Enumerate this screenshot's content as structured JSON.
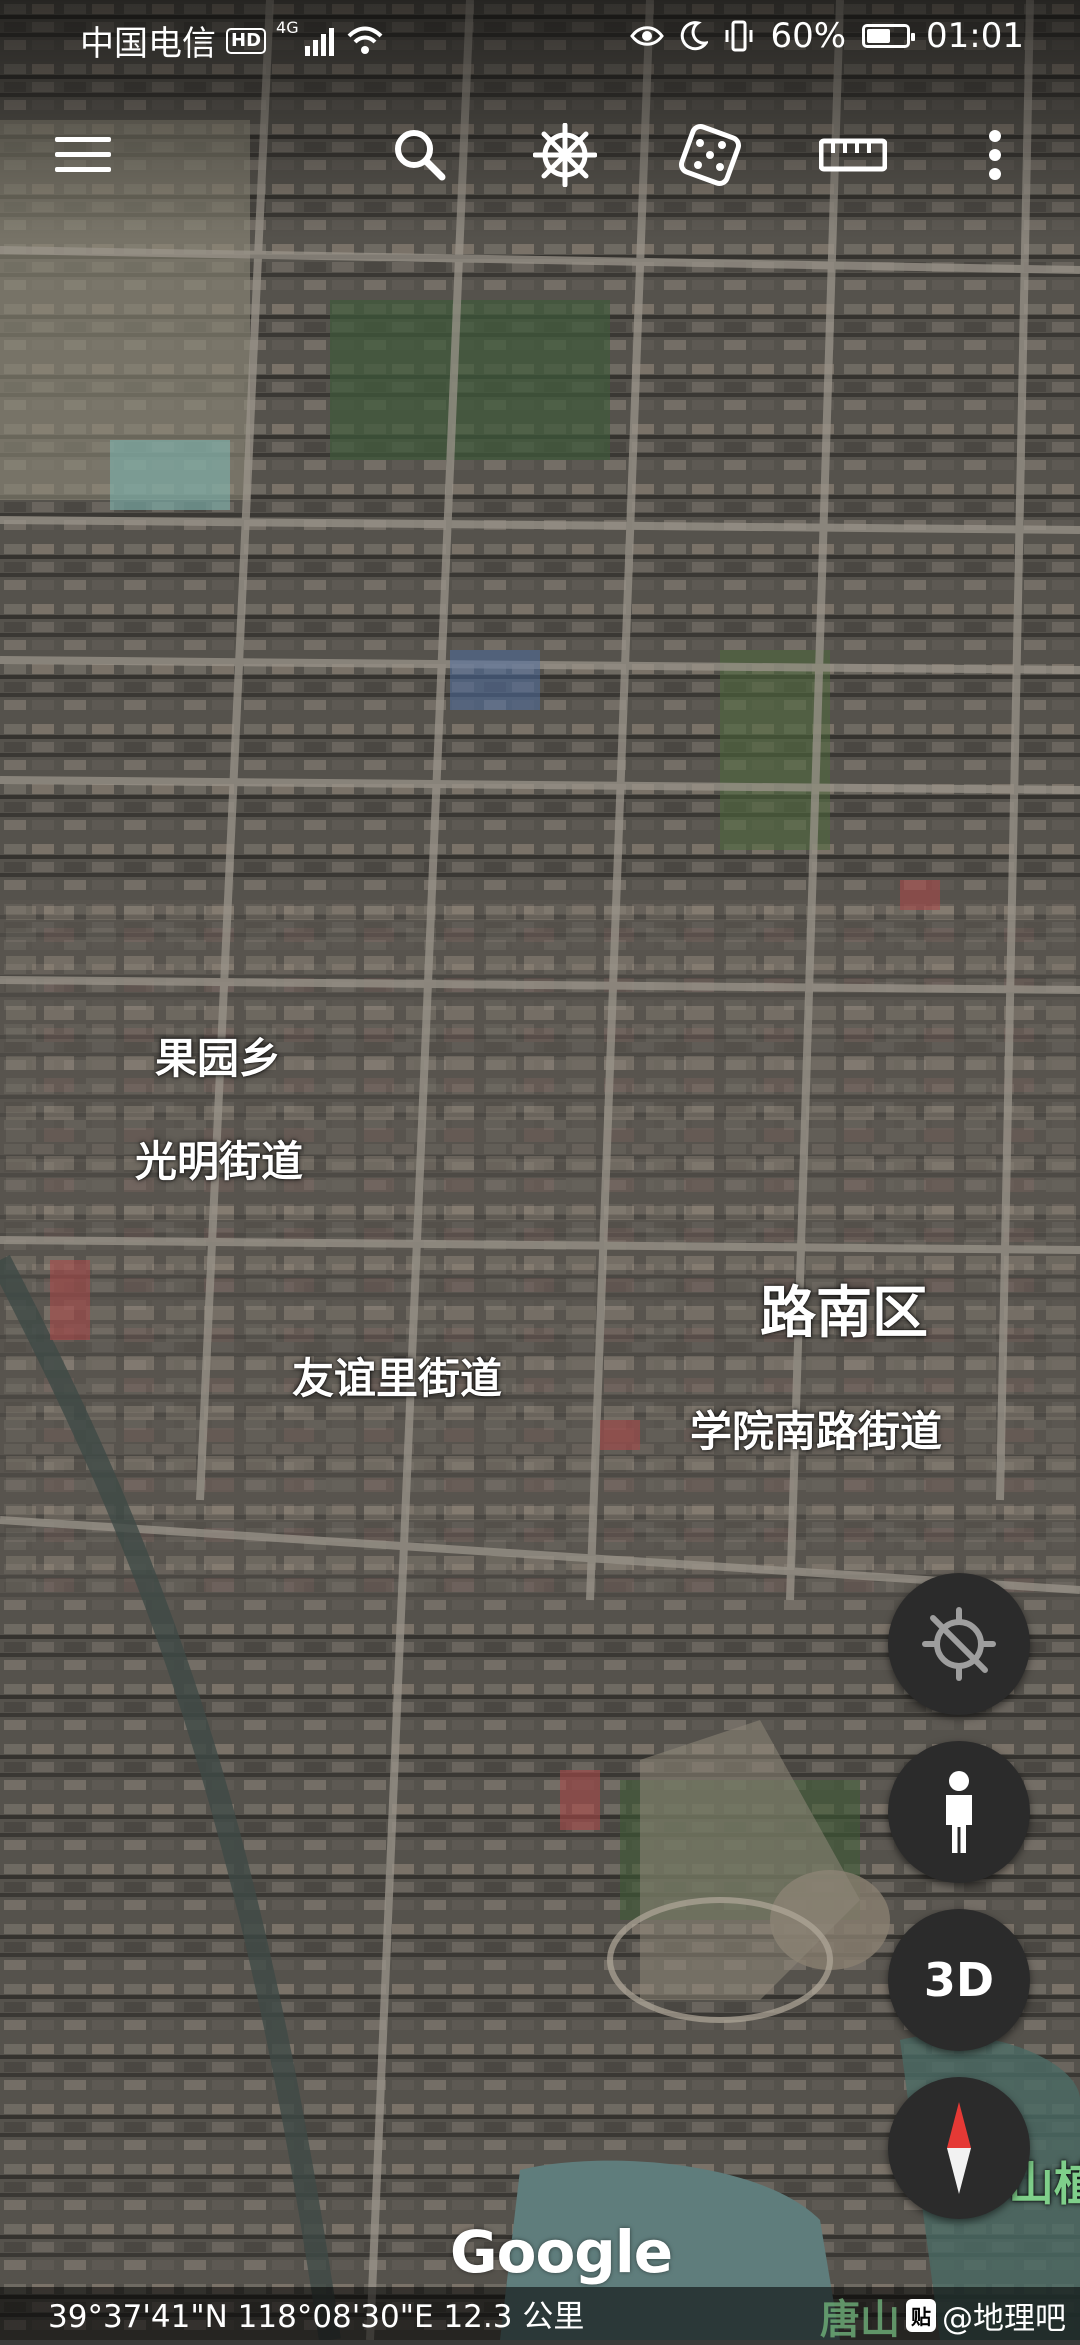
{
  "status_bar": {
    "carrier": "中国电信",
    "hd": "HD",
    "network": "4G",
    "battery": "60%",
    "battery_level": 0.6,
    "time": "01:01"
  },
  "toolbar": {
    "icons": [
      "menu-icon",
      "search-icon",
      "voyager-wheel-icon",
      "dice-icon",
      "ruler-icon",
      "more-icon"
    ]
  },
  "map_labels": {
    "guoyuan": "果园乡",
    "guangming": "光明街道",
    "lunan": "路南区",
    "youyili": "友谊里街道",
    "xueyuan": "学院南路街道",
    "shan": "山植"
  },
  "controls": {
    "locate_icon": "location-off-icon",
    "street_view_icon": "pegman-icon",
    "three_d": "3D",
    "compass_icon": "compass-icon"
  },
  "logo": "Google",
  "bottom_bar": {
    "coords": "39°37'41\"N 118°08'30\"E 12.3 公里",
    "map_text": "唐山",
    "badge": "贴",
    "watermark": "@地理吧"
  },
  "colors": {
    "fab_bg": "#2b2b2b",
    "compass_red": "#e53935"
  }
}
